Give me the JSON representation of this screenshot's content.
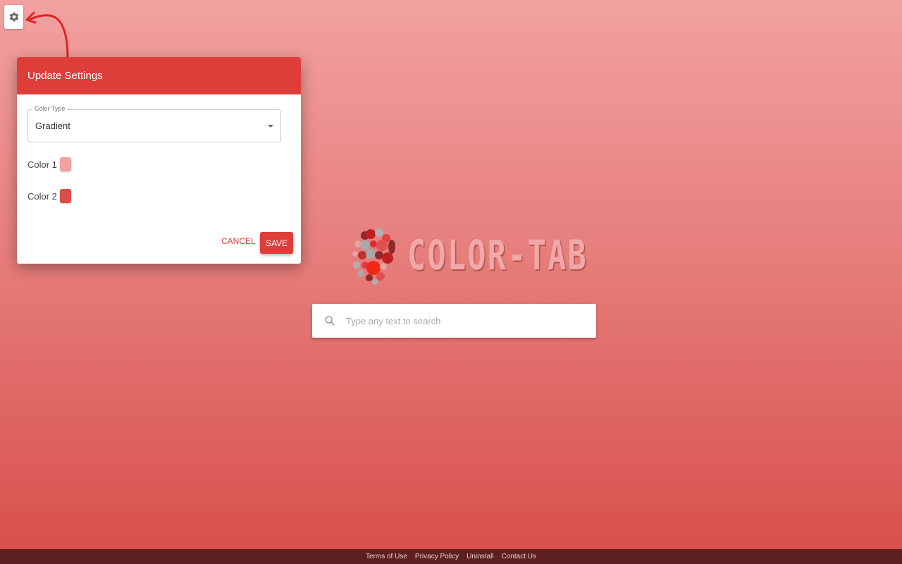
{
  "settings_button": {
    "icon": "gear-icon"
  },
  "dialog": {
    "title": "Update Settings",
    "color_type": {
      "label": "Color Type",
      "value": "Gradient"
    },
    "colors": [
      {
        "label": "Color 1",
        "value": "#f2a1a1"
      },
      {
        "label": "Color 2",
        "value": "#d84e4a"
      }
    ],
    "cancel_label": "CANCEL",
    "save_label": "SAVE"
  },
  "logo": {
    "text": "COLOR-TAB"
  },
  "search": {
    "placeholder": "Type any text to search",
    "value": ""
  },
  "footer": {
    "links": [
      "Terms of Use",
      "Privacy Policy",
      "Uninstall",
      "Contact Us"
    ]
  },
  "theme": {
    "accent": "#de3d3a",
    "footer_bg": "#5e1f1f"
  }
}
